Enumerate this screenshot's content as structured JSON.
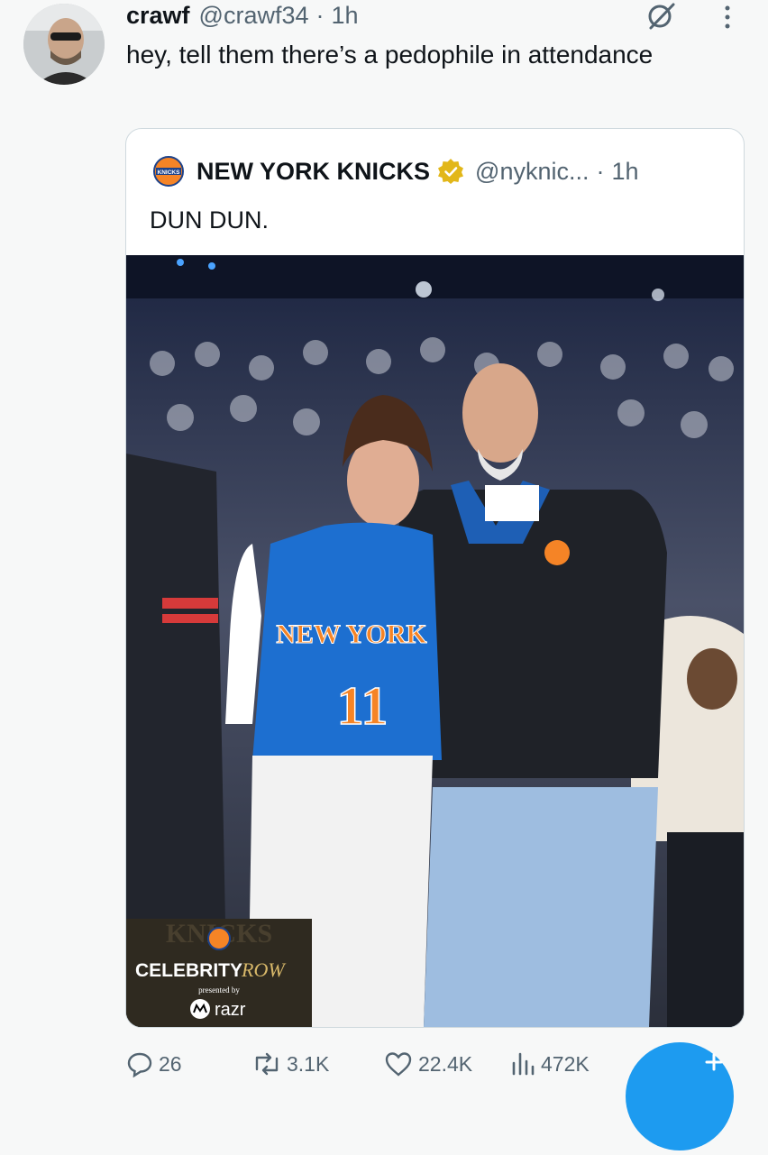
{
  "tweet": {
    "display_name": "crawf",
    "handle": "@crawf34",
    "time": "1h",
    "text": "hey, tell them there’s a pedophile in attendance",
    "separator": "·"
  },
  "quoted_tweet": {
    "display_name": "NEW YORK KNICKS",
    "handle": "@nyknic...",
    "time": "1h",
    "text": "DUN DUN.",
    "separator": "·",
    "image_badge": {
      "line1": "CELEBRITY",
      "line2": "ROW",
      "presented_by": "presented by",
      "sponsor": "razr"
    },
    "jersey_text": "NEW YORK",
    "jersey_number": "11"
  },
  "actions": {
    "replies": "26",
    "reposts": "3.1K",
    "likes": "22.4K",
    "views": "472K"
  },
  "colors": {
    "accent": "#1d9bf0",
    "muted": "#536471",
    "verified_gold": "#e2b719",
    "knicks_blue": "#1d428a",
    "knicks_orange": "#f58426"
  },
  "icons": [
    "grok-icon",
    "more-icon",
    "verified-icon",
    "reply-icon",
    "repost-icon",
    "like-icon",
    "views-icon"
  ]
}
